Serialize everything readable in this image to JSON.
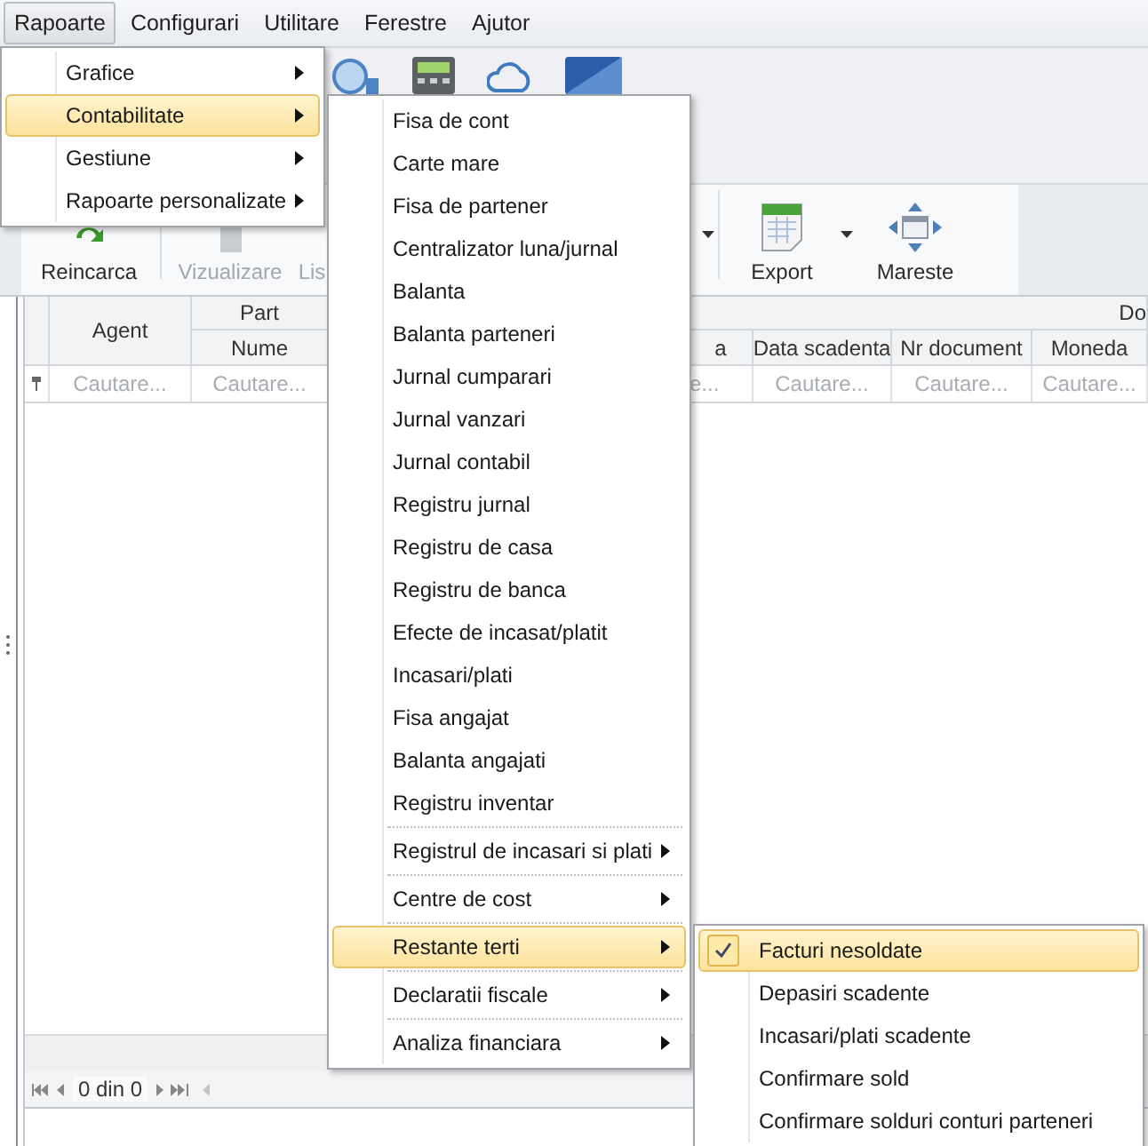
{
  "menubar": [
    {
      "label": "Rapoarte",
      "selected": true
    },
    {
      "label": "Configurari",
      "selected": false
    },
    {
      "label": "Utilitare",
      "selected": false
    },
    {
      "label": "Ferestre",
      "selected": false
    },
    {
      "label": "Ajutor",
      "selected": false
    }
  ],
  "ribbon": {
    "buttons": [
      {
        "label": "Reincarca",
        "disabled": false,
        "kind": "reload"
      },
      {
        "label": "Vizualizare",
        "disabled": true,
        "kind": "view"
      },
      {
        "label": "Lis",
        "disabled": true,
        "kind": "list"
      },
      {
        "label": "Export",
        "disabled": false,
        "kind": "export"
      },
      {
        "label": "Mareste",
        "disabled": false,
        "kind": "maximize"
      }
    ]
  },
  "grid": {
    "group_headers": [
      {
        "label": "Part"
      },
      {
        "label": "Do"
      }
    ],
    "columns": [
      {
        "label": "Agent",
        "placeholder": "Cautare..."
      },
      {
        "label": "Nume",
        "placeholder": "Cautare..."
      },
      {
        "label": "a",
        "placeholder": "e..."
      },
      {
        "label": "Data scadenta",
        "placeholder": "Cautare..."
      },
      {
        "label": "Nr document",
        "placeholder": "Cautare..."
      },
      {
        "label": "Moneda",
        "placeholder": "Cautare..."
      }
    ]
  },
  "navigator": {
    "text": "0 din 0"
  },
  "rapoarte_menu": [
    {
      "label": "Grafice",
      "submenu": true,
      "selected": false
    },
    {
      "label": "Contabilitate",
      "submenu": true,
      "selected": true
    },
    {
      "label": "Gestiune",
      "submenu": true,
      "selected": false
    },
    {
      "label": "Rapoarte personalizate",
      "submenu": true,
      "selected": false
    }
  ],
  "contabilitate_menu": [
    {
      "kind": "item",
      "label": "Fisa de cont",
      "submenu": false,
      "selected": false
    },
    {
      "kind": "item",
      "label": "Carte mare",
      "submenu": false,
      "selected": false
    },
    {
      "kind": "item",
      "label": "Fisa de partener",
      "submenu": false,
      "selected": false
    },
    {
      "kind": "item",
      "label": "Centralizator luna/jurnal",
      "submenu": false,
      "selected": false
    },
    {
      "kind": "item",
      "label": "Balanta",
      "submenu": false,
      "selected": false
    },
    {
      "kind": "item",
      "label": "Balanta parteneri",
      "submenu": false,
      "selected": false
    },
    {
      "kind": "item",
      "label": "Jurnal cumparari",
      "submenu": false,
      "selected": false
    },
    {
      "kind": "item",
      "label": "Jurnal vanzari",
      "submenu": false,
      "selected": false
    },
    {
      "kind": "item",
      "label": "Jurnal contabil",
      "submenu": false,
      "selected": false
    },
    {
      "kind": "item",
      "label": "Registru jurnal",
      "submenu": false,
      "selected": false
    },
    {
      "kind": "item",
      "label": "Registru de casa",
      "submenu": false,
      "selected": false
    },
    {
      "kind": "item",
      "label": "Registru de banca",
      "submenu": false,
      "selected": false
    },
    {
      "kind": "item",
      "label": "Efecte de incasat/platit",
      "submenu": false,
      "selected": false
    },
    {
      "kind": "item",
      "label": "Incasari/plati",
      "submenu": false,
      "selected": false
    },
    {
      "kind": "item",
      "label": "Fisa angajat",
      "submenu": false,
      "selected": false
    },
    {
      "kind": "item",
      "label": "Balanta angajati",
      "submenu": false,
      "selected": false
    },
    {
      "kind": "item",
      "label": "Registru inventar",
      "submenu": false,
      "selected": false
    },
    {
      "kind": "separator"
    },
    {
      "kind": "item",
      "label": "Registrul de incasari si plati",
      "submenu": true,
      "selected": false
    },
    {
      "kind": "separator"
    },
    {
      "kind": "item",
      "label": "Centre de cost",
      "submenu": true,
      "selected": false
    },
    {
      "kind": "separator"
    },
    {
      "kind": "item",
      "label": "Restante terti",
      "submenu": true,
      "selected": true
    },
    {
      "kind": "separator"
    },
    {
      "kind": "item",
      "label": "Declaratii fiscale",
      "submenu": true,
      "selected": false
    },
    {
      "kind": "separator"
    },
    {
      "kind": "item",
      "label": "Analiza financiara",
      "submenu": true,
      "selected": false
    }
  ],
  "restante_menu": [
    {
      "label": "Facturi nesoldate",
      "checked": true,
      "selected": true
    },
    {
      "label": "Depasiri scadente",
      "checked": false,
      "selected": false
    },
    {
      "label": "Incasari/plati scadente",
      "checked": false,
      "selected": false
    },
    {
      "label": "Confirmare sold",
      "checked": false,
      "selected": false
    },
    {
      "label": "Confirmare solduri conturi parteneri",
      "checked": false,
      "selected": false
    }
  ]
}
